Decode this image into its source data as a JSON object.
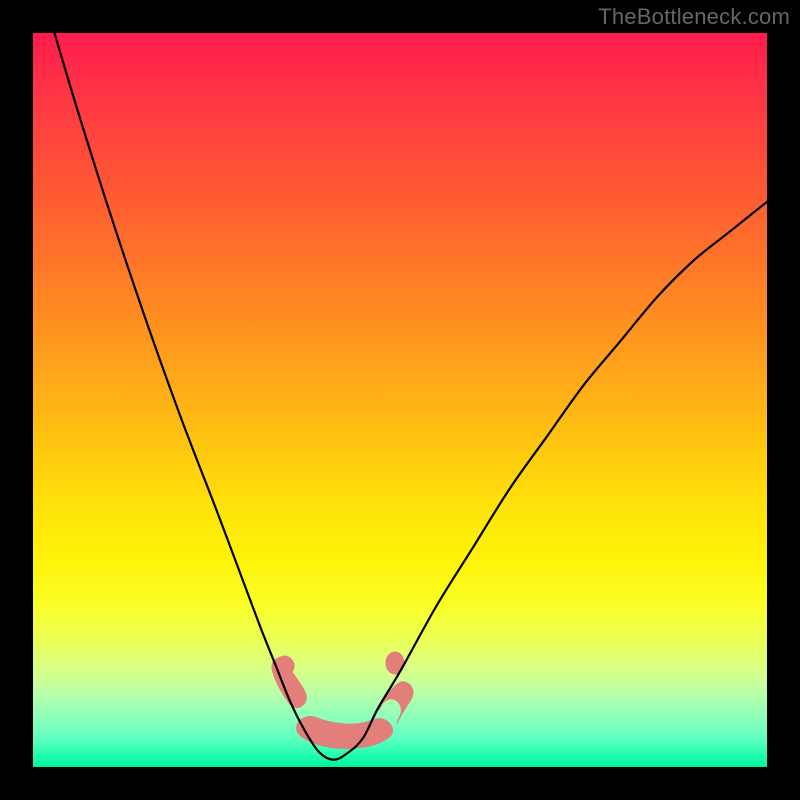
{
  "watermark": "TheBottleneck.com",
  "colors": {
    "salmon": "#e27f7a",
    "curve": "#000000",
    "frame": "#000000"
  },
  "chart_data": {
    "type": "line",
    "title": "",
    "xlabel": "",
    "ylabel": "",
    "xlim": [
      0,
      100
    ],
    "ylim": [
      0,
      100
    ],
    "grid": false,
    "notes": "V-shaped bottleneck curve over a vertical color gradient (red=top=high bottleneck, green=bottom=low bottleneck). Minimum of the curve near x≈41. No axis tick labels or numeric annotations are rendered. Values below are approximate y readings (0=bottom, 100=top) estimated from curve geometry.",
    "series": [
      {
        "name": "bottleneck-curve",
        "x": [
          0,
          5,
          10,
          15,
          20,
          25,
          28,
          31,
          33,
          35,
          37,
          39,
          41,
          43,
          45,
          47,
          50,
          55,
          60,
          65,
          70,
          75,
          80,
          85,
          90,
          95,
          100
        ],
        "y": [
          110,
          93,
          77,
          62,
          48,
          35,
          27,
          19,
          14,
          9,
          5,
          2,
          1,
          2,
          4,
          8,
          13,
          22,
          30,
          38,
          45,
          52,
          58,
          64,
          69,
          73,
          77
        ]
      }
    ],
    "annotations": [
      {
        "name": "salmon-blob-left",
        "approx_x_range": [
          33,
          37
        ],
        "approx_y_range": [
          6,
          15
        ],
        "color": "#e27f7a"
      },
      {
        "name": "salmon-blob-bottom",
        "approx_x_range": [
          37,
          45
        ],
        "approx_y_range": [
          1,
          6
        ],
        "color": "#e27f7a"
      },
      {
        "name": "salmon-blob-right",
        "approx_x_range": [
          44,
          48
        ],
        "approx_y_range": [
          6,
          14
        ],
        "color": "#e27f7a"
      }
    ]
  }
}
